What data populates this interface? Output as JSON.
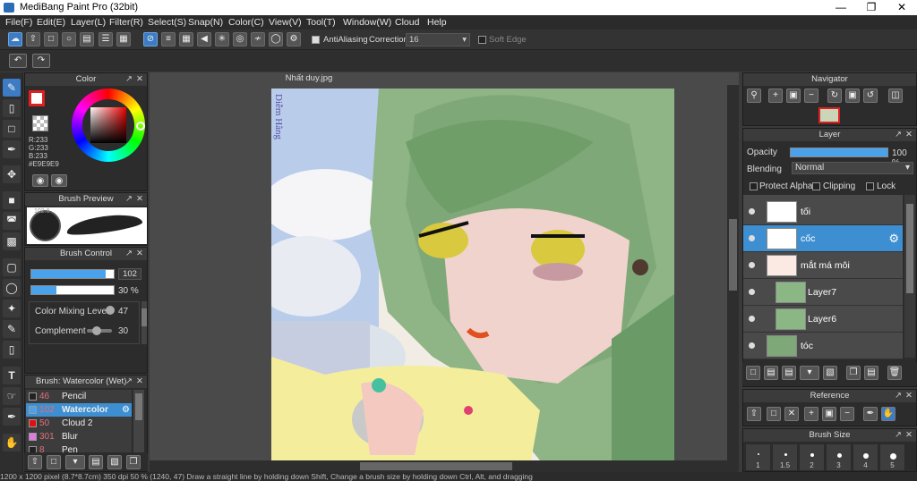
{
  "window": {
    "title": "MediBang Paint Pro (32bit)"
  },
  "menu": [
    "File(F)",
    "Edit(E)",
    "Layer(L)",
    "Filter(R)",
    "Select(S)",
    "Snap(N)",
    "Color(C)",
    "View(V)",
    "Tool(T)",
    "Window(W)",
    "Cloud",
    "Help"
  ],
  "toolbar": {
    "antialiasing_label": "AntiAliasing",
    "correction_label": "Correction",
    "correction_value": "16",
    "soft_edge_label": "Soft Edge"
  },
  "color_panel": {
    "title": "Color",
    "r": "R:233",
    "g": "G:233",
    "b": "B:233",
    "hex": "#E9E9E9"
  },
  "brush_preview": {
    "title": "Brush Preview",
    "size": "102.0"
  },
  "brush_control": {
    "title": "Brush Control",
    "size_value": "102",
    "size_fraction": 0.9,
    "opacity_value": "30 %",
    "opacity_fraction": 0.3,
    "mixing_label": "Color Mixing Level",
    "mixing_value": "47",
    "complement_label": "Complement",
    "complement_value": "30"
  },
  "brush_list": {
    "title": "Brush: Watercolor (Wet)",
    "items": [
      {
        "size": "46",
        "name": "Pencil",
        "color": "#222222"
      },
      {
        "size": "102",
        "name": "Watercolor (Wet)",
        "color": "#4aa3ea"
      },
      {
        "size": "50",
        "name": "Cloud 2",
        "color": "#e01010"
      },
      {
        "size": "301",
        "name": "Blur",
        "color": "#e07ae0"
      },
      {
        "size": "8",
        "name": "Pen",
        "color": "#222222"
      }
    ]
  },
  "document": {
    "tab": "Nhất duy.jpg",
    "signature": "Diễm Hằng"
  },
  "navigator": {
    "title": "Navigator"
  },
  "layer_panel": {
    "title": "Layer",
    "opacity_label": "Opacity",
    "opacity_value": "100 %",
    "blending_label": "Blending",
    "blending_value": "Normal",
    "protect_alpha": "Protect Alpha",
    "clipping": "Clipping",
    "lock": "Lock",
    "layers": [
      {
        "name": "tối",
        "selected": false,
        "clipped": false
      },
      {
        "name": "cốc",
        "selected": true,
        "clipped": false
      },
      {
        "name": "mắt má môi",
        "selected": false,
        "clipped": false
      },
      {
        "name": "Layer7",
        "selected": false,
        "clipped": true
      },
      {
        "name": "Layer6",
        "selected": false,
        "clipped": true
      },
      {
        "name": "tóc",
        "selected": false,
        "clipped": false
      }
    ]
  },
  "reference": {
    "title": "Reference"
  },
  "brush_size": {
    "title": "Brush Size",
    "labels": [
      "1",
      "1.5",
      "2",
      "3",
      "4",
      "5"
    ]
  },
  "status": {
    "text": "1200 x 1200 pixel   (8.7*8.7cm)   350 dpi   50 %   (1240, 47)   Draw a straight line by holding down Shift, Change a brush size by holding down Ctrl, Alt, and dragging"
  }
}
